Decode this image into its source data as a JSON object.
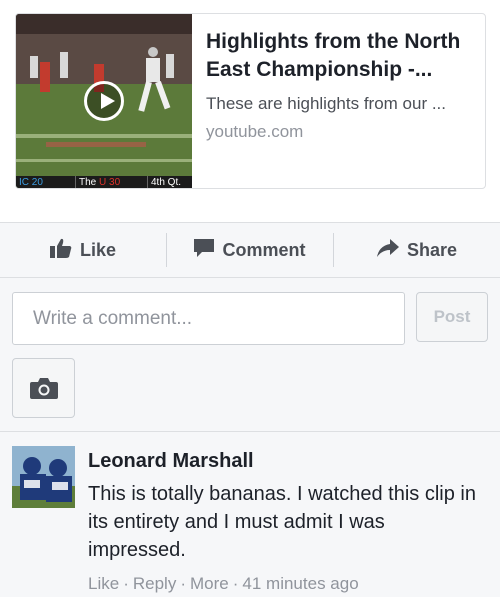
{
  "link_preview": {
    "title": "Highlights from the North East Championship -...",
    "description": "These are highlights from our ...",
    "domain": "youtube.com",
    "scoreboard": {
      "team_a": "IC 20",
      "team_b_prefix": "The ",
      "team_b_score": "U 30",
      "quarter": "4th Qt."
    }
  },
  "actions": {
    "like": "Like",
    "comment": "Comment",
    "share": "Share"
  },
  "compose": {
    "placeholder": "Write a comment...",
    "post_label": "Post"
  },
  "comment": {
    "author": "Leonard Marshall",
    "text": "This is totally bananas. I watched this clip in its entirety and I must admit I was impressed.",
    "meta": {
      "like": "Like",
      "reply": "Reply",
      "more": "More",
      "time": "41 minutes ago",
      "separator": "·"
    }
  },
  "colors": {
    "accent_gray": "#4b4f56",
    "muted": "#90949c",
    "bg_gray": "#f6f7f9",
    "border": "#dddfe2"
  }
}
